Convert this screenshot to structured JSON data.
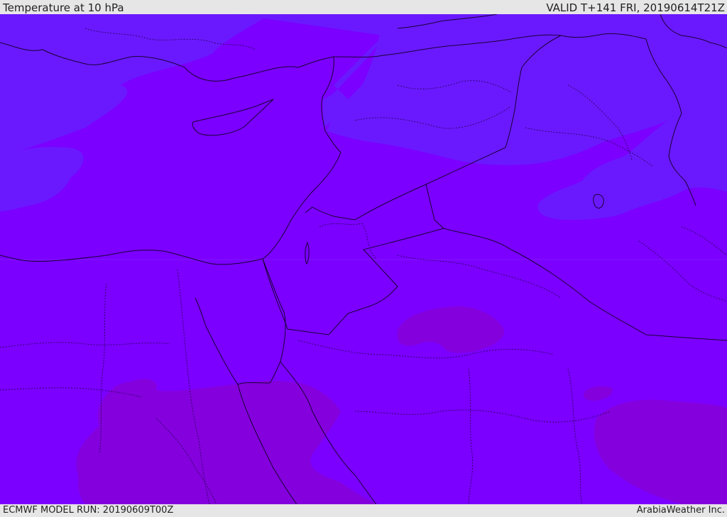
{
  "header": {
    "title": "Temperature at 10 hPa",
    "valid": "VALID T+141 FRI, 20190614T21Z"
  },
  "footer": {
    "model_run": "ECMWF MODEL RUN: 20190609T00Z",
    "credit": "ArabiaWeather Inc."
  },
  "colors": {
    "field_main": "#7b00ff",
    "field_cold": "#6a19ff",
    "field_warm": "#8400dd",
    "border": "#1a0033"
  }
}
